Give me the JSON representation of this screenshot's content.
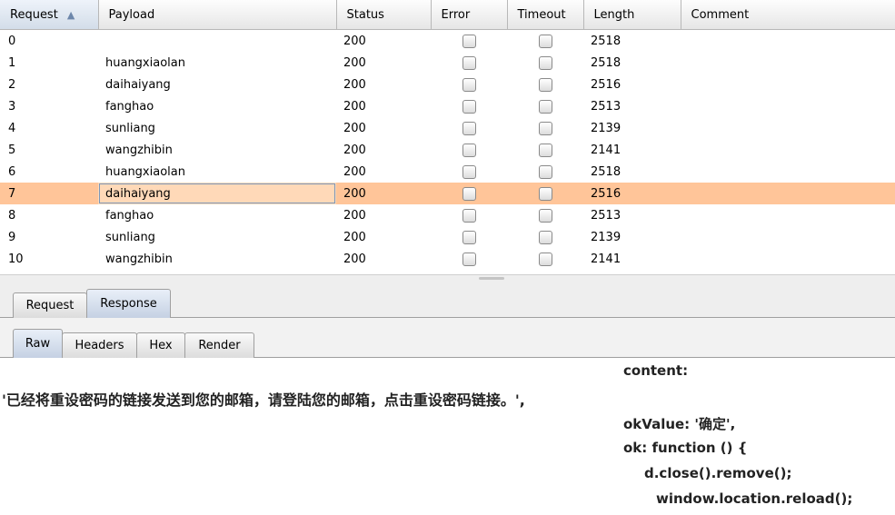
{
  "table": {
    "columns": [
      "Request",
      "Payload",
      "Status",
      "Error",
      "Timeout",
      "Length",
      "Comment"
    ],
    "rows": [
      {
        "request": "0",
        "payload": "",
        "status": "200",
        "length": "2518",
        "comment": ""
      },
      {
        "request": "1",
        "payload": "huangxiaolan",
        "status": "200",
        "length": "2518",
        "comment": ""
      },
      {
        "request": "2",
        "payload": "daihaiyang",
        "status": "200",
        "length": "2516",
        "comment": ""
      },
      {
        "request": "3",
        "payload": "fanghao",
        "status": "200",
        "length": "2513",
        "comment": ""
      },
      {
        "request": "4",
        "payload": "sunliang",
        "status": "200",
        "length": "2139",
        "comment": ""
      },
      {
        "request": "5",
        "payload": "wangzhibin",
        "status": "200",
        "length": "2141",
        "comment": ""
      },
      {
        "request": "6",
        "payload": "huangxiaolan",
        "status": "200",
        "length": "2518",
        "comment": ""
      },
      {
        "request": "7",
        "payload": "daihaiyang",
        "status": "200",
        "length": "2516",
        "comment": "",
        "selected": true
      },
      {
        "request": "8",
        "payload": "fanghao",
        "status": "200",
        "length": "2513",
        "comment": ""
      },
      {
        "request": "9",
        "payload": "sunliang",
        "status": "200",
        "length": "2139",
        "comment": ""
      },
      {
        "request": "10",
        "payload": "wangzhibin",
        "status": "200",
        "length": "2141",
        "comment": ""
      }
    ]
  },
  "tabs_outer": {
    "request": "Request",
    "response": "Response",
    "active": "Response"
  },
  "tabs_inner": {
    "raw": "Raw",
    "headers": "Headers",
    "hex": "Hex",
    "render": "Render",
    "active": "Raw"
  },
  "response_body": {
    "line1": "content:",
    "line2": "'已经将重设密码的链接发送到您的邮箱，请登陆您的邮箱，点击重设密码链接。',",
    "line3": "okValue: '确定',",
    "line4": "ok: function () {",
    "line5": "d.close().remove();",
    "line6": "window.location.reload();"
  },
  "colors": {
    "selected_row": "#ffc599",
    "sorted_header": "#d3dde9"
  }
}
